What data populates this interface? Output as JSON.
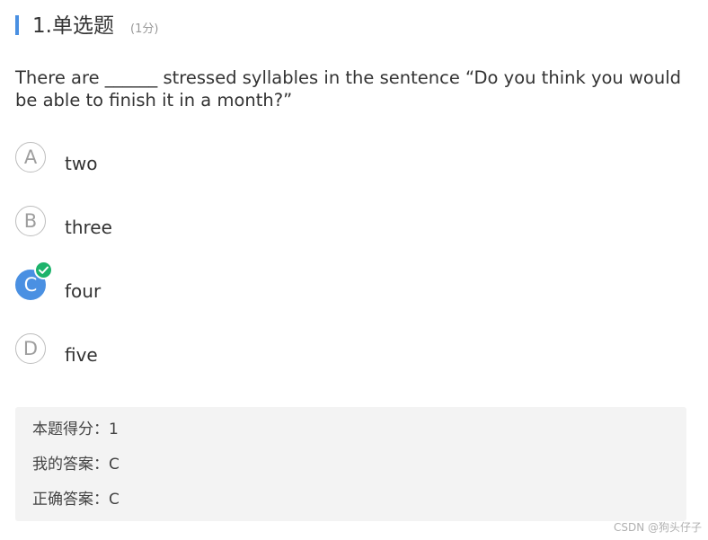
{
  "question_header": {
    "title": "1.单选题",
    "score": "(1分)"
  },
  "question": {
    "text": "There are ______ stressed syllables in the sentence   “Do you think you would be able to finish it in a month?”"
  },
  "options": [
    {
      "letter": "A",
      "text": "two",
      "selected": false
    },
    {
      "letter": "B",
      "text": "three",
      "selected": false
    },
    {
      "letter": "C",
      "text": "four",
      "selected": true
    },
    {
      "letter": "D",
      "text": "five",
      "selected": false
    }
  ],
  "result": {
    "score_line": "本题得分：1",
    "my_answer_line": "我的答案：C",
    "correct_answer_line": "正确答案：C"
  },
  "watermark": "CSDN @狗头仔子",
  "colors": {
    "accent": "#4a90e2",
    "check": "#1db36b",
    "panel_bg": "#f3f3f3"
  },
  "icons": {
    "selected_marker": "checkmark-icon"
  }
}
